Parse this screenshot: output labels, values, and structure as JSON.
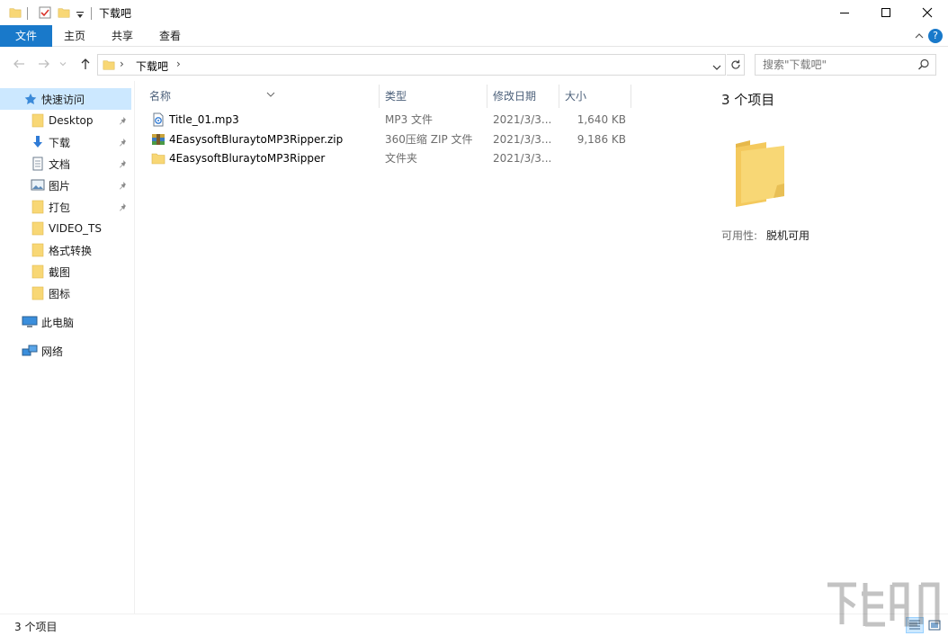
{
  "window": {
    "title": "下载吧"
  },
  "ribbon": {
    "tabs": [
      {
        "label": "文件",
        "active": true
      },
      {
        "label": "主页"
      },
      {
        "label": "共享"
      },
      {
        "label": "查看"
      }
    ],
    "help_glyph": "?"
  },
  "address": {
    "breadcrumb": "下载吧",
    "search_placeholder": "搜索\"下载吧\""
  },
  "nav_pane": {
    "quick_access": "快速访问",
    "items": [
      {
        "label": "Desktop",
        "icon": "folder-icon",
        "pinned": true
      },
      {
        "label": "下载",
        "icon": "download-arrow-icon",
        "pinned": true
      },
      {
        "label": "文档",
        "icon": "document-icon",
        "pinned": true
      },
      {
        "label": "图片",
        "icon": "pictures-icon",
        "pinned": true
      },
      {
        "label": "打包",
        "icon": "folder-icon",
        "pinned": true
      },
      {
        "label": "VIDEO_TS",
        "icon": "folder-icon",
        "pinned": false
      },
      {
        "label": "格式转换",
        "icon": "folder-icon",
        "pinned": false
      },
      {
        "label": "截图",
        "icon": "folder-icon",
        "pinned": false
      },
      {
        "label": "图标",
        "icon": "folder-icon",
        "pinned": false
      }
    ],
    "this_pc": "此电脑",
    "network": "网络"
  },
  "file_list": {
    "columns": {
      "name": "名称",
      "type": "类型",
      "date": "修改日期",
      "size": "大小"
    },
    "rows": [
      {
        "name": "Title_01.mp3",
        "type": "MP3 文件",
        "date": "2021/3/3...",
        "size": "1,640 KB",
        "icon": "mp3-file-icon"
      },
      {
        "name": "4EasysoftBluraytoMP3Ripper.zip",
        "type": "360压缩 ZIP 文件",
        "date": "2021/3/3...",
        "size": "9,186 KB",
        "icon": "zip-archive-icon"
      },
      {
        "name": "4EasysoftBluraytoMP3Ripper",
        "type": "文件夹",
        "date": "2021/3/3...",
        "size": "",
        "icon": "folder-icon"
      }
    ]
  },
  "details_pane": {
    "count": "3 个项目",
    "availability_label": "可用性:",
    "availability_value": "脱机可用"
  },
  "status_bar": {
    "text": "3 个项目"
  },
  "colors": {
    "accent": "#1979ca",
    "selection": "#cce8ff",
    "folder": "#f8d775"
  }
}
